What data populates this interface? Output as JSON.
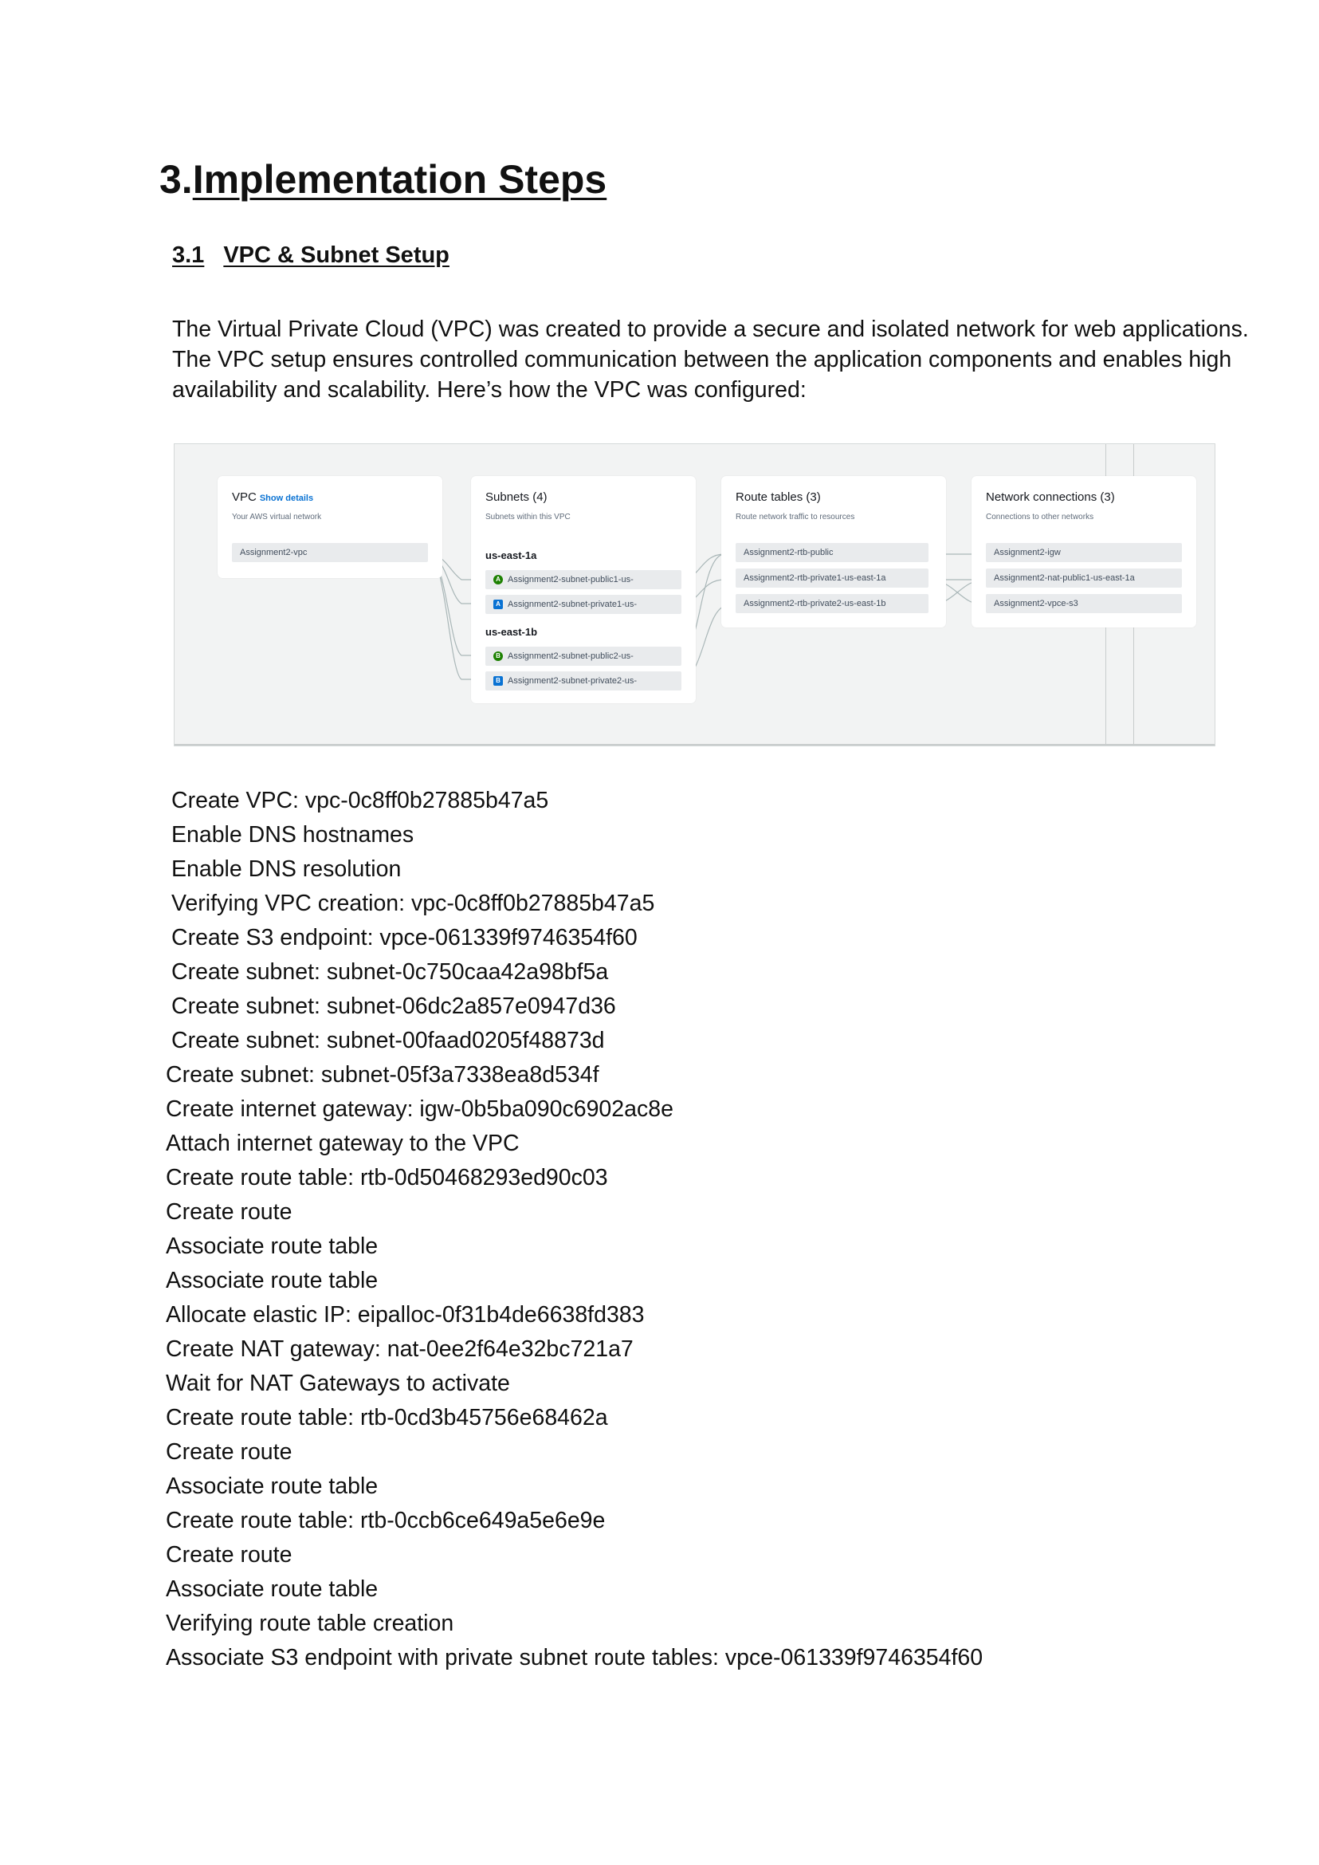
{
  "heading": {
    "number": "3.",
    "title": "Implementation Steps"
  },
  "subheading": {
    "number": "3.1",
    "title": "VPC & Subnet Setup"
  },
  "intro_paragraph": "The Virtual Private Cloud (VPC) was created to provide a secure and isolated network for web applications. The VPC setup ensures controlled communication between the application components and enables high availability and scalability. Here’s how the VPC was configured:",
  "diagram": {
    "vpc_card": {
      "title": "VPC",
      "link": "Show details",
      "subtitle": "Your AWS virtual network",
      "item": "Assignment2-vpc"
    },
    "subnets_card": {
      "title": "Subnets (4)",
      "subtitle": "Subnets within this VPC",
      "az1": "us-east-1a",
      "az1_subnets": [
        {
          "badge": "A",
          "kind": "public",
          "label": "Assignment2-subnet-public1-us-"
        },
        {
          "badge": "A",
          "kind": "private",
          "label": "Assignment2-subnet-private1-us-"
        }
      ],
      "az2": "us-east-1b",
      "az2_subnets": [
        {
          "badge": "B",
          "kind": "public",
          "label": "Assignment2-subnet-public2-us-"
        },
        {
          "badge": "B",
          "kind": "private",
          "label": "Assignment2-subnet-private2-us-"
        }
      ]
    },
    "route_tables_card": {
      "title": "Route tables (3)",
      "subtitle": "Route network traffic to resources",
      "items": [
        "Assignment2-rtb-public",
        "Assignment2-rtb-private1-us-east-1a",
        "Assignment2-rtb-private2-us-east-1b"
      ]
    },
    "network_card": {
      "title": "Network connections (3)",
      "subtitle": "Connections to other networks",
      "items": [
        "Assignment2-igw",
        "Assignment2-nat-public1-us-east-1a",
        "Assignment2-vpce-s3"
      ]
    },
    "colors": {
      "public_badge": "#1d8102",
      "private_badge": "#0972d3",
      "link": "#0972d3"
    }
  },
  "steps": [
    "Create VPC: vpc-0c8ff0b27885b47a5",
    "Enable DNS hostnames",
    "Enable DNS resolution",
    "Verifying VPC creation: vpc-0c8ff0b27885b47a5",
    "Create S3 endpoint: vpce-061339f9746354f60",
    "Create subnet: subnet-0c750caa42a98bf5a",
    "Create subnet: subnet-06dc2a857e0947d36",
    "Create subnet: subnet-00faad0205f48873d",
    "Create subnet: subnet-05f3a7338ea8d534f",
    "Create internet gateway: igw-0b5ba090c6902ac8e",
    "Attach internet gateway to the VPC",
    "Create route table: rtb-0d50468293ed90c03",
    "Create route",
    "Associate route table",
    "Associate route table",
    "Allocate elastic IP: eipalloc-0f31b4de6638fd383",
    "Create NAT gateway: nat-0ee2f64e32bc721a7",
    "Wait for NAT Gateways to activate",
    "Create route table: rtb-0cd3b45756e68462a",
    "Create route",
    "Associate route table",
    "Create route table: rtb-0ccb6ce649a5e6e9e",
    "Create route",
    "Associate route table",
    "Verifying route table creation",
    "Associate S3 endpoint with private subnet route tables: vpce-061339f9746354f60"
  ]
}
